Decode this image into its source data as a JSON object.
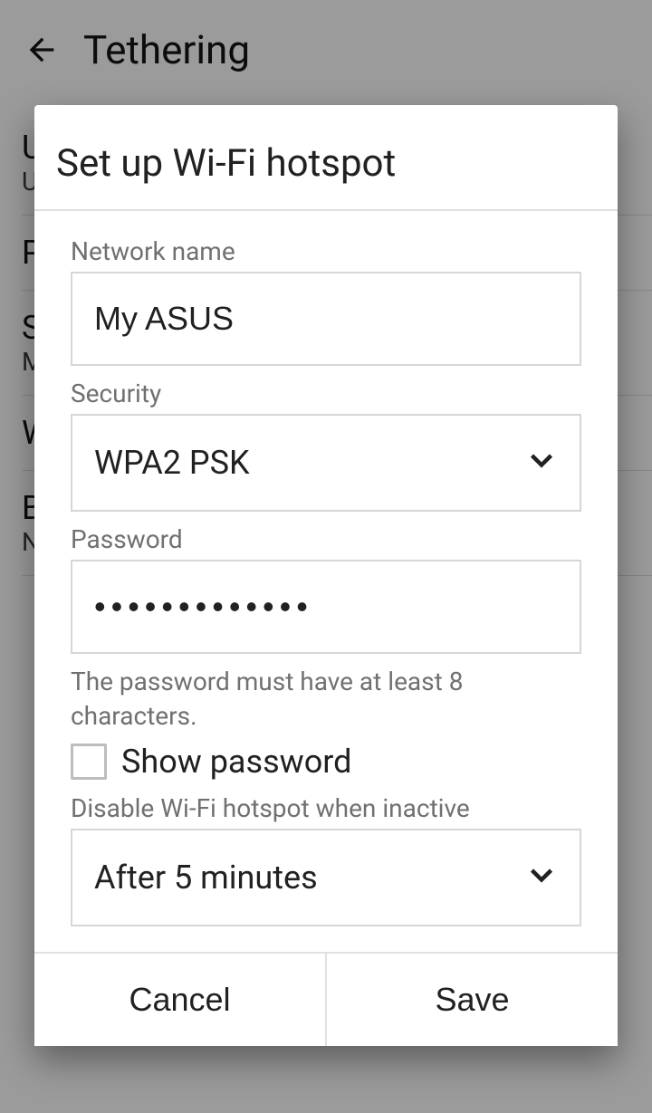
{
  "background": {
    "title": "Tethering"
  },
  "dialog": {
    "title": "Set up Wi-Fi hotspot",
    "network_name": {
      "label": "Network name",
      "value": "My ASUS"
    },
    "security": {
      "label": "Security",
      "value": "WPA2 PSK"
    },
    "password": {
      "label": "Password",
      "value": "•••••••••••••",
      "hint": "The password must have at least 8 characters."
    },
    "show_password": {
      "label": "Show password",
      "checked": false
    },
    "disable_when_inactive": {
      "label": "Disable Wi-Fi hotspot when inactive",
      "value": "After 5 minutes"
    },
    "actions": {
      "cancel": "Cancel",
      "save": "Save"
    }
  }
}
